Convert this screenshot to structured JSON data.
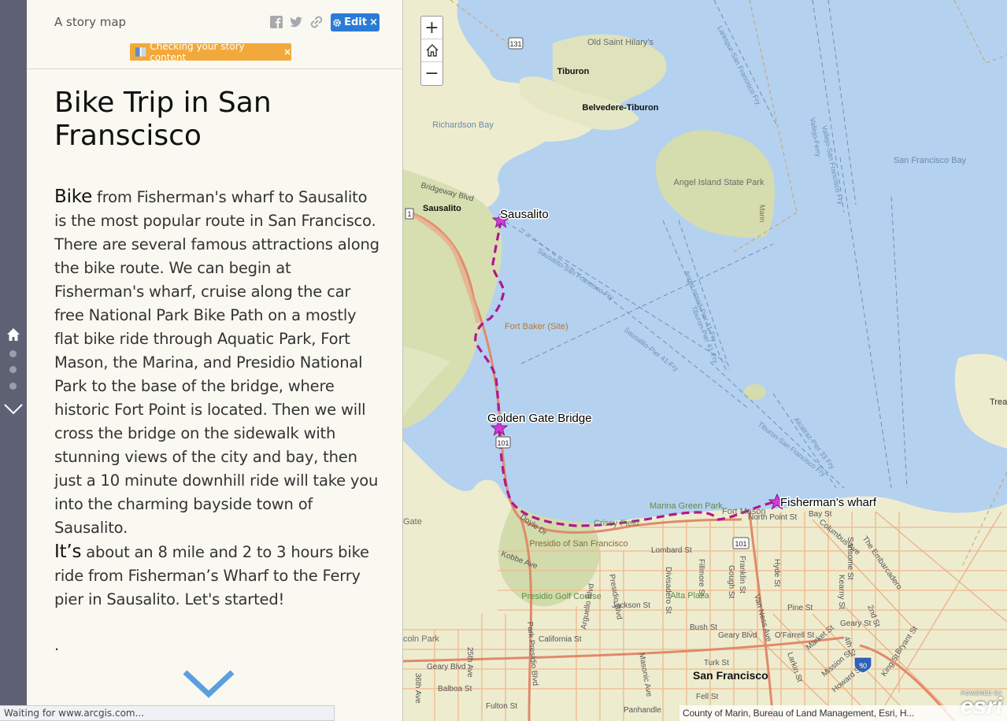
{
  "panel": {
    "subtitle": "A story map",
    "edit_label": "Edit",
    "edit_close": "×",
    "banner_label": "Checking your story content",
    "banner_close": "×",
    "title": "Bike Trip in San Franscisco",
    "story_p1_lead": "Bike",
    "story_p1_rest": " from Fisherman's wharf to Sausalito is the most popular route in San Francisco. There are several famous attractions along the bike route. We can begin at Fisherman's wharf, cruise along the car free National Park Bike Path on a mostly flat bike ride through Aquatic Park, Fort Mason, the Marina, and Presidio National Park to the base of the bridge, where historic Fort Point is located. Then we will cross the bridge on the sidewalk with stunning views of the city and bay, then just a 10 minute downhill ride will take you into the charming bayside town of Sausalito.",
    "story_p2_lead": "It’s",
    "story_p2_rest": " about an 8 mile and 2 to 3 hours bike ride from Fisherman’s Wharf to the Ferry pier in Sausalito. Let's started!",
    "story_p3": "."
  },
  "icons": {
    "facebook": "facebook-icon",
    "twitter": "twitter-icon",
    "link": "link-icon",
    "gear": "gear-icon",
    "home": "home-icon",
    "chevron_down": "chevron-down-icon",
    "book": "book-icon"
  },
  "colors": {
    "accent_blue": "#2b7bd6",
    "banner_orange": "#f2a93b",
    "route_magenta": "#b0188e",
    "rail": "#5e6173",
    "water": "#b4d1ef",
    "land": "#eeeccf"
  },
  "status": {
    "text": "Waiting for www.arcgis.com..."
  },
  "map": {
    "zoom_in": "+",
    "zoom_out": "−",
    "attribution": "County of Marin, Bureau of Land Management, Esri, H...",
    "powered_by": "POWERED BY",
    "esri": "esri",
    "stops": {
      "sausalito": "Sausalito",
      "golden_gate": "Golden Gate Bridge",
      "fishermans": "Fisherman's wharf"
    },
    "places": {
      "old_saint_hilary": "Old Saint Hilary's",
      "tiburon": "Tiburon",
      "belvedere": "Belvedere-Tiburon",
      "richardson_bay": "Richardson Bay",
      "angel_island": "Angel Island State Park",
      "sf_bay": "San Francisco Bay",
      "sausalito_city": "Sausalito",
      "fort_baker": "Fort Baker (Site)",
      "marina_green": "Marina Green Park",
      "fort_mason": "Fort Mason",
      "presidio": "Presidio of San Francisco",
      "presidio_golf": "Presidio Golf Course",
      "alta_plaza": "Alta Plaza",
      "san_francisco": "San Francisco",
      "treasure_island": "Treasu Islan",
      "crissy_field": "Crissy Field",
      "gate": "Gate",
      "lincoln_park": "coln Park"
    },
    "streets": {
      "lombard": "Lombard St",
      "bay": "Bay St",
      "north_point": "North Point St",
      "jackson": "Jackson St",
      "california": "California St",
      "geary": "Geary Blvd",
      "bush": "Bush St",
      "pine": "Pine St",
      "turk": "Turk St",
      "fell": "Fell St",
      "ofarrell": "O'Farrell St",
      "balboa": "Balboa St",
      "fulton": "Fulton St",
      "panhandle": "Panhandle",
      "doyle": "Doyle Dr",
      "kobbe": "Kobbe Ave",
      "bridgeway": "Bridgeway Blvd",
      "columbus": "Columbus Ave",
      "embarcadero": "The Embarcadero",
      "market": "Market St",
      "mission": "Mission St",
      "van_ness": "Van Ness Ave",
      "divisadero": "Divisadero St",
      "fillmore": "Fillmore St",
      "franklin": "Franklin St",
      "gough": "Gough St",
      "hyde": "Hyde St",
      "kearny": "Kearny St",
      "sansome": "Sansome St",
      "park_presidio": "Park Presidio Blvd",
      "arguello": "Arguello Blvd",
      "masonic": "Masonic Ave",
      "second": "2nd St",
      "fourth": "4th St",
      "king": "King St",
      "bryant": "Bryant St",
      "howard": "Howard St",
      "larkin": "Larkin St",
      "geary_st": "Geary St",
      "av25": "25th Ave",
      "av36": "36th Ave",
      "presidio_blvd": "Presidio Blvd"
    },
    "ferries": {
      "larkspur": "Larkspur-San Francisco Fry",
      "vallejo_ferry": "Vallejo-Ferry",
      "vallejo_sf": "Vallejo-San Francisco Fry",
      "sausalito_sf": "Sausalito-San Francisco Fry",
      "sausalito_pier": "Sausalito-Pier 41-Fry",
      "angel_pier": "Angel Island-Pier 41-Fry",
      "tiburon_pier": "Tiburon-Pier 41-Fry",
      "tiburon_sf": "Tiburon-San Francisco Fry",
      "alcatraz": "Alcatraz-Pier 33 Fry",
      "marin": "Marin"
    },
    "shields": {
      "r131": "131",
      "r101_a": "101",
      "r101_b": "101",
      "i80": "80",
      "r1": "1"
    }
  }
}
